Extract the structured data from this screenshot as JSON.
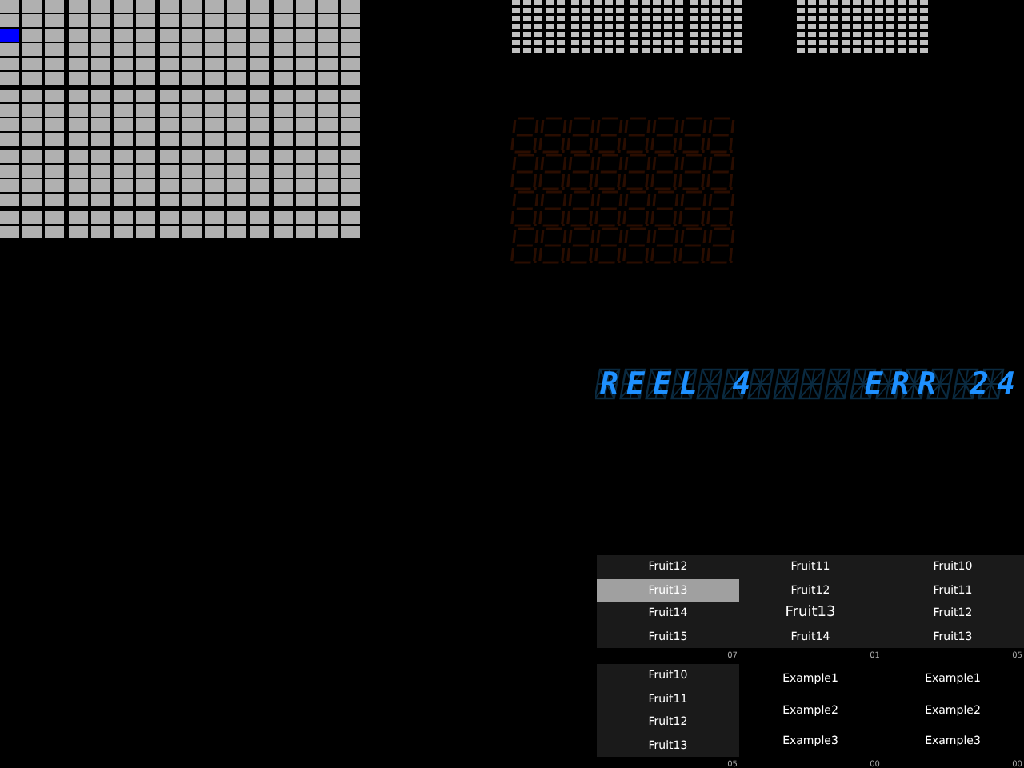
{
  "lamp_matrix": [
    [
      {
        "on": false
      },
      {
        "on": false
      },
      {
        "on": false
      },
      {
        "on": false
      },
      {
        "on": false
      },
      {
        "on": false
      },
      {
        "on": false
      },
      {
        "on": false
      },
      {
        "on": false
      },
      {
        "on": false
      },
      {
        "on": false
      },
      {
        "on": false
      },
      {
        "on": false
      },
      {
        "on": false
      },
      {
        "on": false
      },
      {
        "on": false
      }
    ],
    [
      {
        "on": false
      },
      {
        "on": false
      },
      {
        "on": false
      },
      {
        "on": false
      },
      {
        "on": false
      },
      {
        "on": false
      },
      {
        "on": false
      },
      {
        "on": false
      },
      {
        "on": false
      },
      {
        "on": false
      },
      {
        "on": false
      },
      {
        "on": false
      },
      {
        "on": false
      },
      {
        "on": false
      },
      {
        "on": false
      },
      {
        "on": false
      }
    ],
    [
      {
        "on": true
      },
      {
        "on": false
      },
      {
        "on": false
      },
      {
        "on": false
      },
      {
        "on": false
      },
      {
        "on": false
      },
      {
        "on": false
      },
      {
        "on": false
      },
      {
        "on": false
      },
      {
        "on": false
      },
      {
        "on": false
      },
      {
        "on": false
      },
      {
        "on": false
      },
      {
        "on": false
      },
      {
        "on": false
      },
      {
        "on": false
      }
    ],
    [
      {
        "on": false
      },
      {
        "on": false
      },
      {
        "on": false
      },
      {
        "on": false
      },
      {
        "on": false
      },
      {
        "on": false
      },
      {
        "on": false
      },
      {
        "on": false
      },
      {
        "on": false
      },
      {
        "on": false
      },
      {
        "on": false
      },
      {
        "on": false
      },
      {
        "on": false
      },
      {
        "on": false
      },
      {
        "on": false
      },
      {
        "on": false
      }
    ],
    [
      {
        "on": false
      },
      {
        "on": false
      },
      {
        "on": false
      },
      {
        "on": false
      },
      {
        "on": false
      },
      {
        "on": false
      },
      {
        "on": false
      },
      {
        "on": false
      },
      {
        "on": false
      },
      {
        "on": false
      },
      {
        "on": false
      },
      {
        "on": false
      },
      {
        "on": false
      },
      {
        "on": false
      },
      {
        "on": false
      },
      {
        "on": false
      }
    ],
    [
      {
        "on": false
      },
      {
        "on": false
      },
      {
        "on": false
      },
      {
        "on": false
      },
      {
        "on": false
      },
      {
        "on": false
      },
      {
        "on": false
      },
      {
        "on": false
      },
      {
        "on": false
      },
      {
        "on": false
      },
      {
        "on": false
      },
      {
        "on": false
      },
      {
        "on": false
      },
      {
        "on": false
      },
      {
        "on": false
      },
      {
        "on": false
      }
    ],
    [
      {
        "on": false
      },
      {
        "on": false
      },
      {
        "on": false
      },
      {
        "on": false
      },
      {
        "on": false
      },
      {
        "on": false
      },
      {
        "on": false
      },
      {
        "on": false
      },
      {
        "on": false
      },
      {
        "on": false
      },
      {
        "on": false
      },
      {
        "on": false
      },
      {
        "on": false
      },
      {
        "on": false
      },
      {
        "on": false
      },
      {
        "on": false
      }
    ],
    [
      {
        "on": false
      },
      {
        "on": false
      },
      {
        "on": false
      },
      {
        "on": false
      },
      {
        "on": false
      },
      {
        "on": false
      },
      {
        "on": false
      },
      {
        "on": false
      },
      {
        "on": false
      },
      {
        "on": false
      },
      {
        "on": false
      },
      {
        "on": false
      },
      {
        "on": false
      },
      {
        "on": false
      },
      {
        "on": false
      },
      {
        "on": false
      }
    ],
    [
      {
        "on": false
      },
      {
        "on": false
      },
      {
        "on": false
      },
      {
        "on": false
      },
      {
        "on": false
      },
      {
        "on": false
      },
      {
        "on": false
      },
      {
        "on": false
      },
      {
        "on": false
      },
      {
        "on": false
      },
      {
        "on": false
      },
      {
        "on": false
      },
      {
        "on": false
      },
      {
        "on": false
      },
      {
        "on": false
      },
      {
        "on": false
      }
    ],
    [
      {
        "on": false
      },
      {
        "on": false
      },
      {
        "on": false
      },
      {
        "on": false
      },
      {
        "on": false
      },
      {
        "on": false
      },
      {
        "on": false
      },
      {
        "on": false
      },
      {
        "on": false
      },
      {
        "on": false
      },
      {
        "on": false
      },
      {
        "on": false
      },
      {
        "on": false
      },
      {
        "on": false
      },
      {
        "on": false
      },
      {
        "on": false
      }
    ],
    [
      {
        "on": false
      },
      {
        "on": false
      },
      {
        "on": false
      },
      {
        "on": false
      },
      {
        "on": false
      },
      {
        "on": false
      },
      {
        "on": false
      },
      {
        "on": false
      },
      {
        "on": false
      },
      {
        "on": false
      },
      {
        "on": false
      },
      {
        "on": false
      },
      {
        "on": false
      },
      {
        "on": false
      },
      {
        "on": false
      },
      {
        "on": false
      }
    ],
    [
      {
        "on": false
      },
      {
        "on": false
      },
      {
        "on": false
      },
      {
        "on": false
      },
      {
        "on": false
      },
      {
        "on": false
      },
      {
        "on": false
      },
      {
        "on": false
      },
      {
        "on": false
      },
      {
        "on": false
      },
      {
        "on": false
      },
      {
        "on": false
      },
      {
        "on": false
      },
      {
        "on": false
      },
      {
        "on": false
      },
      {
        "on": false
      }
    ],
    [
      {
        "on": false
      },
      {
        "on": false
      },
      {
        "on": false
      },
      {
        "on": false
      },
      {
        "on": false
      },
      {
        "on": false
      },
      {
        "on": false
      },
      {
        "on": false
      },
      {
        "on": false
      },
      {
        "on": false
      },
      {
        "on": false
      },
      {
        "on": false
      },
      {
        "on": false
      },
      {
        "on": false
      },
      {
        "on": false
      },
      {
        "on": false
      }
    ],
    [
      {
        "on": false
      },
      {
        "on": false
      },
      {
        "on": false
      },
      {
        "on": false
      },
      {
        "on": false
      },
      {
        "on": false
      },
      {
        "on": false
      },
      {
        "on": false
      },
      {
        "on": false
      },
      {
        "on": false
      },
      {
        "on": false
      },
      {
        "on": false
      },
      {
        "on": false
      },
      {
        "on": false
      },
      {
        "on": false
      },
      {
        "on": false
      }
    ],
    [
      {
        "on": false
      },
      {
        "on": false
      },
      {
        "on": false
      },
      {
        "on": false
      },
      {
        "on": false
      },
      {
        "on": false
      },
      {
        "on": false
      },
      {
        "on": false
      },
      {
        "on": false
      },
      {
        "on": false
      },
      {
        "on": false
      },
      {
        "on": false
      },
      {
        "on": false
      },
      {
        "on": false
      },
      {
        "on": false
      },
      {
        "on": false
      }
    ],
    [
      {
        "on": false
      },
      {
        "on": false
      },
      {
        "on": false
      },
      {
        "on": false
      },
      {
        "on": false
      },
      {
        "on": false
      },
      {
        "on": false
      },
      {
        "on": false
      },
      {
        "on": false
      },
      {
        "on": false
      },
      {
        "on": false
      },
      {
        "on": false
      },
      {
        "on": false
      },
      {
        "on": false
      },
      {
        "on": false
      },
      {
        "on": false
      }
    ]
  ],
  "vfd_display": {
    "text": "REEL 4    ERR 24"
  },
  "reels": [
    {
      "label": "07",
      "symbols": [
        {
          "text": "Fruit12",
          "selected": false,
          "payline": false
        },
        {
          "text": "Fruit13",
          "selected": true,
          "payline": false
        },
        {
          "text": "Fruit14",
          "selected": false,
          "payline": false
        },
        {
          "text": "Fruit15",
          "selected": false,
          "payline": false
        }
      ]
    },
    {
      "label": "01",
      "symbols": [
        {
          "text": "Fruit11",
          "selected": false,
          "payline": false
        },
        {
          "text": "Fruit12",
          "selected": false,
          "payline": false
        },
        {
          "text": "Fruit13",
          "selected": false,
          "payline": true
        },
        {
          "text": "Fruit14",
          "selected": false,
          "payline": false
        }
      ]
    },
    {
      "label": "05",
      "symbols": [
        {
          "text": "Fruit10",
          "selected": false,
          "payline": false
        },
        {
          "text": "Fruit11",
          "selected": false,
          "payline": false
        },
        {
          "text": "Fruit12",
          "selected": false,
          "payline": false
        },
        {
          "text": "Fruit13",
          "selected": false,
          "payline": false
        }
      ]
    },
    {
      "label": "05",
      "symbols": [
        {
          "text": "Fruit10",
          "selected": false,
          "payline": false
        },
        {
          "text": "Fruit11",
          "selected": false,
          "payline": false
        },
        {
          "text": "Fruit12",
          "selected": false,
          "payline": false
        },
        {
          "text": "Fruit13",
          "selected": false,
          "payline": false
        }
      ]
    },
    {
      "label": "00",
      "symbols": [
        {
          "text": "Example1",
          "selected": false,
          "payline": false
        },
        {
          "text": "Example2",
          "selected": false,
          "payline": false
        },
        {
          "text": "Example3",
          "selected": false,
          "payline": false
        }
      ]
    },
    {
      "label": "00",
      "symbols": [
        {
          "text": "Example1",
          "selected": false,
          "payline": false
        },
        {
          "text": "Example2",
          "selected": false,
          "payline": false
        },
        {
          "text": "Example3",
          "selected": false,
          "payline": false
        }
      ]
    }
  ]
}
